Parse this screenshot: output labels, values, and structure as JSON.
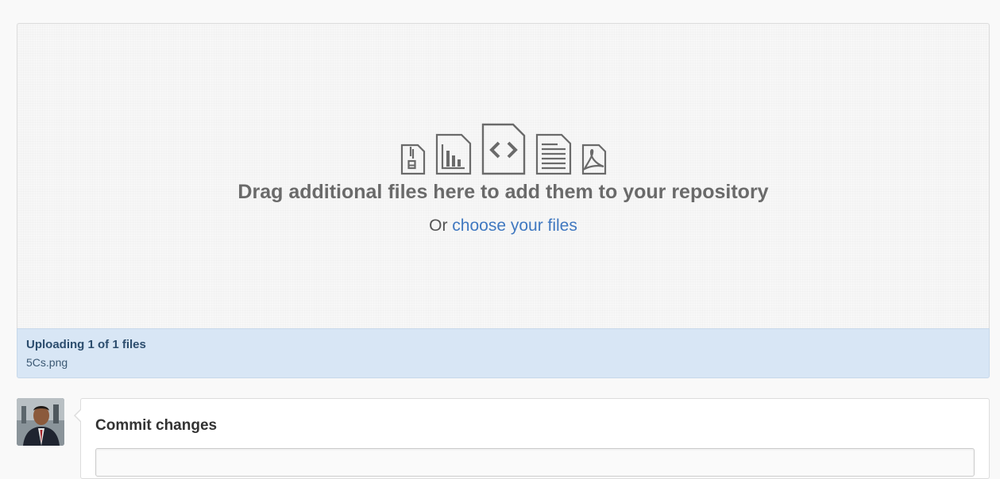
{
  "dropzone": {
    "title": "Drag additional files here to add them to your repository",
    "sub_prefix": "Or ",
    "choose_link": "choose your files",
    "file_type_icons": [
      "file-zip-icon",
      "file-chart-icon",
      "file-code-icon",
      "file-text-icon",
      "file-pdf-icon"
    ]
  },
  "upload": {
    "status_title": "Uploading 1 of 1 files",
    "file_name": "5Cs.png"
  },
  "commit": {
    "title": "Commit changes"
  },
  "colors": {
    "link": "#4078c0",
    "upload_bg": "#d8e6f5",
    "icon_stroke": "#6a6a6a"
  }
}
